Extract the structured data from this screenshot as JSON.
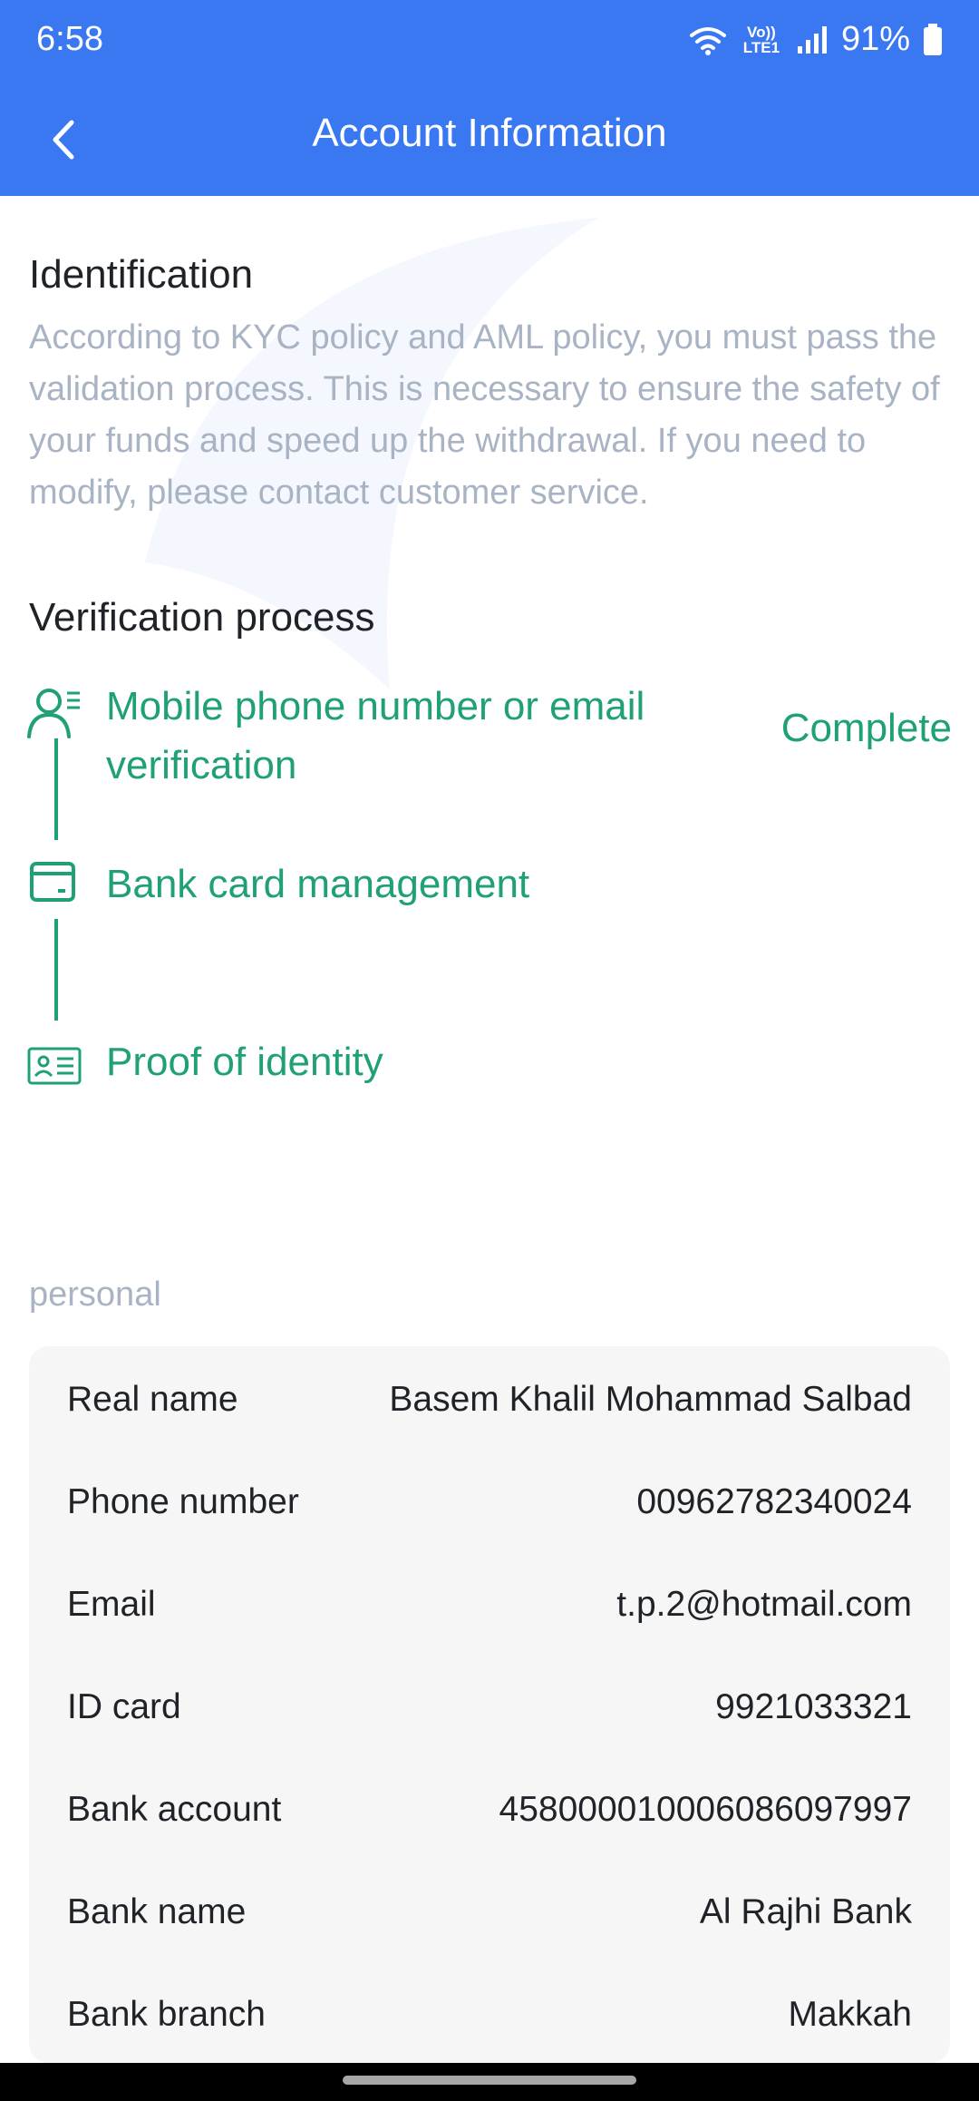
{
  "status": {
    "time": "6:58",
    "network": "Vo)) LTE1",
    "battery": "91%"
  },
  "header": {
    "title": "Account Information"
  },
  "identification": {
    "title": "Identification",
    "description": "According to KYC policy and AML policy, you must pass the validation process. This is necessary to ensure the safety of your funds and speed up the withdrawal. If you need to modify, please contact customer service."
  },
  "verification": {
    "title": "Verification process",
    "steps": [
      {
        "label": "Mobile phone number or email verification",
        "status": "Complete",
        "icon": "user-list-icon"
      },
      {
        "label": "Bank card management",
        "status": "",
        "icon": "card-icon"
      },
      {
        "label": "Proof of identity",
        "status": "",
        "icon": "id-card-icon"
      }
    ]
  },
  "personal": {
    "section_label": "personal",
    "rows": [
      {
        "label": "Real name",
        "value": "Basem Khalil Mohammad Salbad"
      },
      {
        "label": "Phone number",
        "value": "00962782340024"
      },
      {
        "label": "Email",
        "value": "t.p.2@hotmail.com"
      },
      {
        "label": "ID card",
        "value": "9921033321"
      },
      {
        "label": "Bank account",
        "value": "458000010006086097997"
      },
      {
        "label": "Bank name",
        "value": "Al Rajhi Bank"
      },
      {
        "label": "Bank branch",
        "value": "Makkah"
      }
    ]
  },
  "colors": {
    "header_bg": "#3a78f2",
    "accent_green": "#1fa174",
    "muted_text": "#a8b3c4",
    "card_bg": "#f6f6f6"
  }
}
